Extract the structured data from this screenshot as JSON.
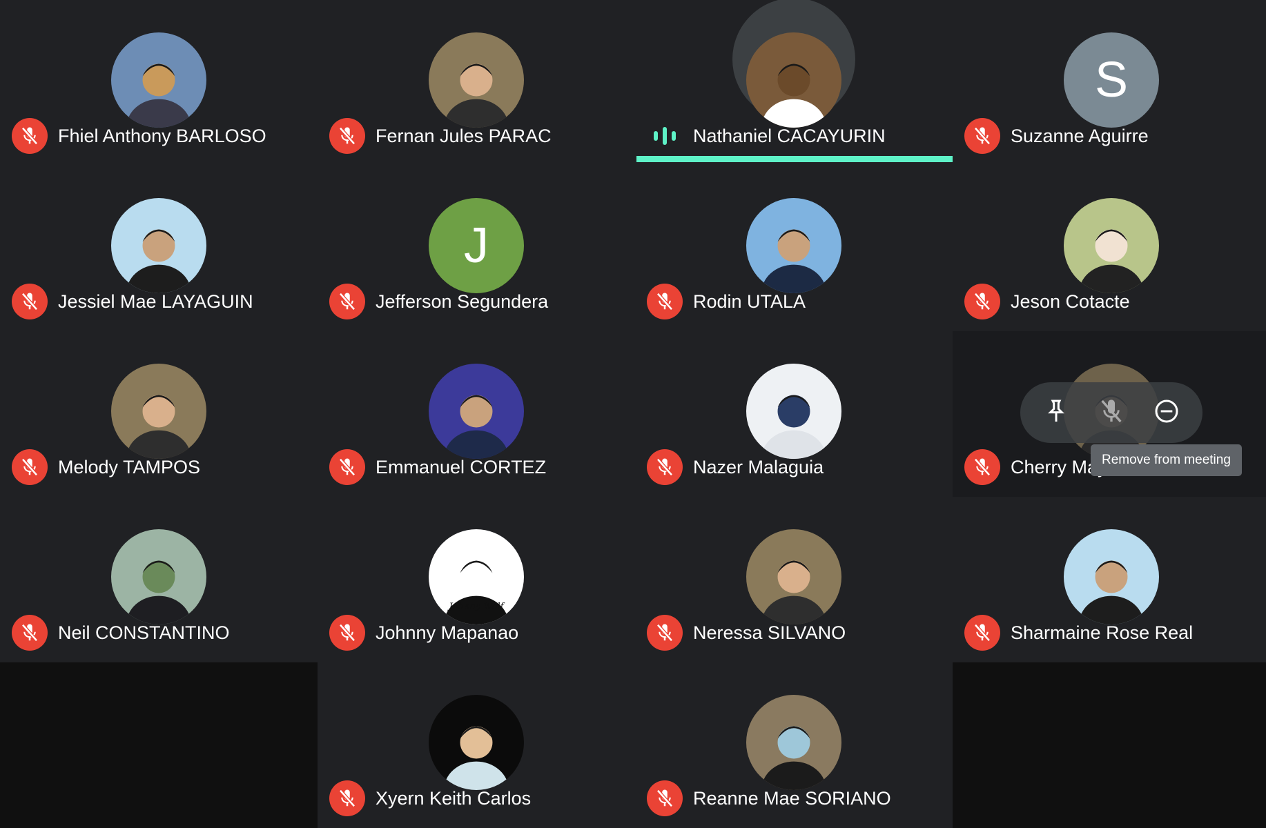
{
  "participants": [
    {
      "name": "Fhiel Anthony BARLOSO",
      "avatar": "photo-cuartel-sign",
      "muted": true
    },
    {
      "name": "Fernan Jules PARAC",
      "avatar": "photo-portrait",
      "muted": true
    },
    {
      "name": "Nathaniel CACAYURIN",
      "avatar": "photo-outdoor",
      "muted": false,
      "speaking": true
    },
    {
      "name": "Suzanne Aguirre",
      "avatar_initial": "S",
      "muted": true
    },
    {
      "name": "Jessiel Mae LAYAGUIN",
      "avatar": "photo-seated",
      "muted": true
    },
    {
      "name": "Jefferson Segundera",
      "avatar_initial": "J",
      "muted": true
    },
    {
      "name": "Rodin UTALA",
      "avatar": "photo-flag",
      "muted": true
    },
    {
      "name": "Jeson Cotacte",
      "avatar": "anime-character",
      "muted": true
    },
    {
      "name": "Melody TAMPOS",
      "avatar": "photo-portrait",
      "muted": true
    },
    {
      "name": "Emmanuel CORTEZ",
      "avatar": "photo-roses",
      "muted": true
    },
    {
      "name": "Nazer Malaguia",
      "avatar": "robot-illustration",
      "muted": true
    },
    {
      "name": "Cherry May DUREZA",
      "avatar": "photo-portrait",
      "muted": true,
      "hovered": true
    },
    {
      "name": "Neil CONSTANTINO",
      "avatar": "photo-landscape",
      "muted": true
    },
    {
      "name": "Johnny Mapanao",
      "avatar": "cartoon-sunglasses",
      "avatar_text": "Johnny Wolf",
      "muted": true
    },
    {
      "name": "Neressa SILVANO",
      "avatar": "photo-portrait",
      "muted": true
    },
    {
      "name": "Sharmaine Rose Real",
      "avatar": "photo-seated",
      "muted": true
    },
    {
      "name": "Xyern Keith Carlos",
      "avatar": "cartoon-hoodie",
      "muted": true
    },
    {
      "name": "Reanne Mae SORIANO",
      "avatar": "photo-masked",
      "muted": true
    }
  ],
  "hover_menu": {
    "buttons": [
      {
        "icon": "pin-icon"
      },
      {
        "icon": "mic-off-icon"
      },
      {
        "icon": "remove-circle-icon"
      }
    ],
    "tooltip": "Remove from meeting"
  },
  "colors": {
    "tile_bg": "#202124",
    "page_bg": "#101010",
    "muted_badge": "#ea4335",
    "speaking_accent": "#5ef2c7",
    "initial_s_bg": "#7b8a94",
    "initial_j_bg": "#6ea045"
  }
}
